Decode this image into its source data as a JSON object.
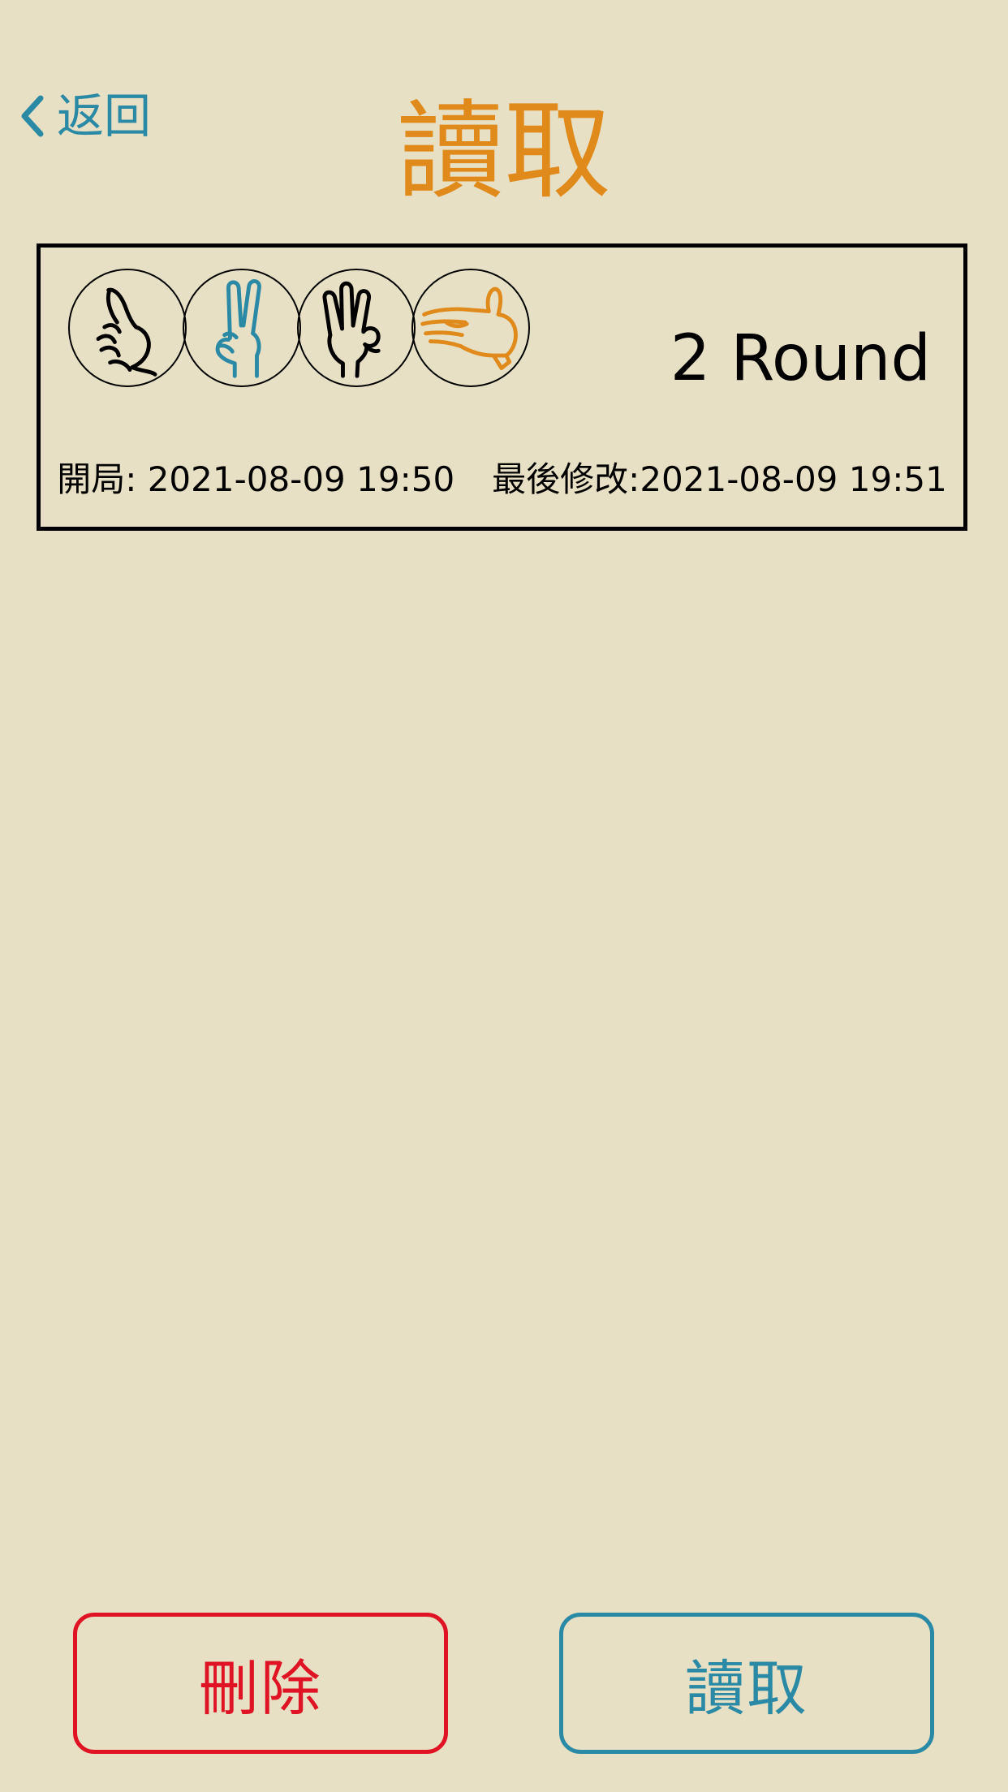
{
  "nav": {
    "back_label": "返回",
    "back_icon": "chevron-left-icon"
  },
  "page": {
    "title": "讀取"
  },
  "save_slot": {
    "gesture_icons": [
      {
        "name": "pointing-hand-icon",
        "color": "#000000"
      },
      {
        "name": "peace-hand-icon",
        "color": "#2a8aa5"
      },
      {
        "name": "ok-hand-icon",
        "color": "#000000"
      },
      {
        "name": "open-palm-hand-icon",
        "color": "#df8a1b"
      }
    ],
    "round_label": "2 Round",
    "start_label": "開局: 2021-08-09 19:50",
    "modified_label": "最後修改:2021-08-09 19:51"
  },
  "actions": {
    "delete_label": "刪除",
    "load_label": "讀取"
  },
  "colors": {
    "background": "#e8e0c4",
    "title": "#df8a1b",
    "accent": "#2a8aa5",
    "danger": "#df1323"
  }
}
